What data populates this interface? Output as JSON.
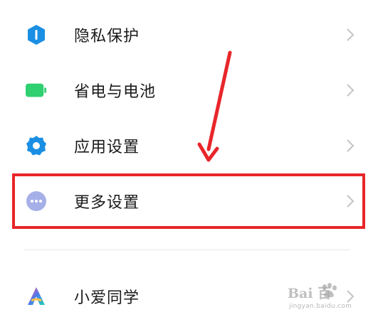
{
  "settings": {
    "items": [
      {
        "label": "隐私保护",
        "icon": "shield-icon",
        "color": "#1a8fe3"
      },
      {
        "label": "省电与电池",
        "icon": "battery-icon",
        "color": "#2fd070"
      },
      {
        "label": "应用设置",
        "icon": "gear-icon",
        "color": "#1a8fe3"
      },
      {
        "label": "更多设置",
        "icon": "more-dots-icon",
        "color": "#a6b0e8"
      },
      {
        "label": "小爱同学",
        "icon": "xiaoai-icon",
        "color": "#4a7cf0"
      }
    ]
  },
  "annotation": {
    "highlight_color": "#e8262a",
    "highlighted_item": "更多设置"
  },
  "watermark": {
    "brand": "Bai 百",
    "subtitle": "jingyan.baidu.com"
  }
}
